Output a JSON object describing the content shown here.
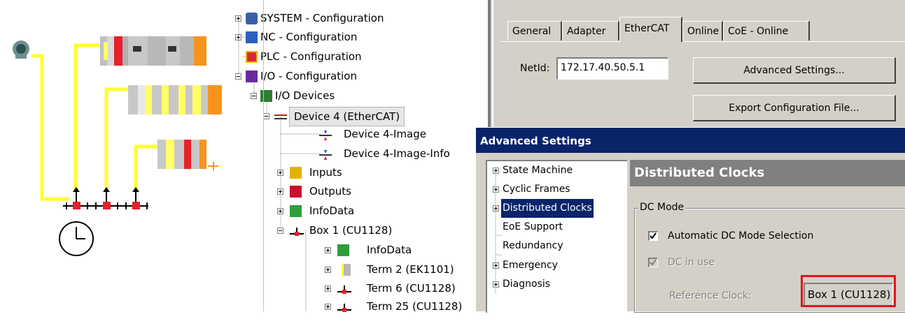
{
  "tree": {
    "items": [
      {
        "label": "SYSTEM - Configuration"
      },
      {
        "label": "NC - Configuration"
      },
      {
        "label": "PLC - Configuration"
      },
      {
        "label": "I/O - Configuration"
      },
      {
        "label": "I/O Devices"
      },
      {
        "label": "Device 4 (EtherCAT)"
      },
      {
        "label": "Device 4-Image"
      },
      {
        "label": "Device 4-Image-Info"
      },
      {
        "label": "Inputs"
      },
      {
        "label": "Outputs"
      },
      {
        "label": "InfoData"
      },
      {
        "label": "Box 1 (CU1128)"
      },
      {
        "label": "InfoData"
      },
      {
        "label": "Term 2 (EK1101)"
      },
      {
        "label": "Term 6 (CU1128)"
      },
      {
        "label": "Term 25 (CU1128)"
      }
    ]
  },
  "props": {
    "tabs": [
      "General",
      "Adapter",
      "EtherCAT",
      "Online",
      "CoE - Online"
    ],
    "active_tab": "EtherCAT",
    "netid_label": "NetId:",
    "netid_value": "172.17.40.50.5.1",
    "advanced_button": "Advanced Settings...",
    "export_button": "Export Configuration File..."
  },
  "advanced": {
    "title": "Advanced Settings",
    "nav": [
      {
        "label": "State Machine"
      },
      {
        "label": "Cyclic Frames"
      },
      {
        "label": "Distributed Clocks"
      },
      {
        "label": "EoE Support"
      },
      {
        "label": "Redundancy"
      },
      {
        "label": "Emergency"
      },
      {
        "label": "Diagnosis"
      }
    ],
    "selected_nav": "Distributed Clocks",
    "section_title": "Distributed Clocks",
    "group_label": "DC Mode",
    "auto_dc_label": "Automatic DC Mode Selection",
    "auto_dc_checked": true,
    "dc_in_use_label": "DC in use",
    "dc_in_use_checked": true,
    "reference_clock_label": "Reference Clock:",
    "reference_clock_value": "Box 1 (CU1128)"
  },
  "colors": {
    "title_bar": "#0a246a",
    "dialog_bg": "#d4d0c8",
    "highlight_box": "#e3141b",
    "ethercat_bus": "#ffff33",
    "module_red": "#e8202a",
    "module_orange": "#f7941d"
  }
}
